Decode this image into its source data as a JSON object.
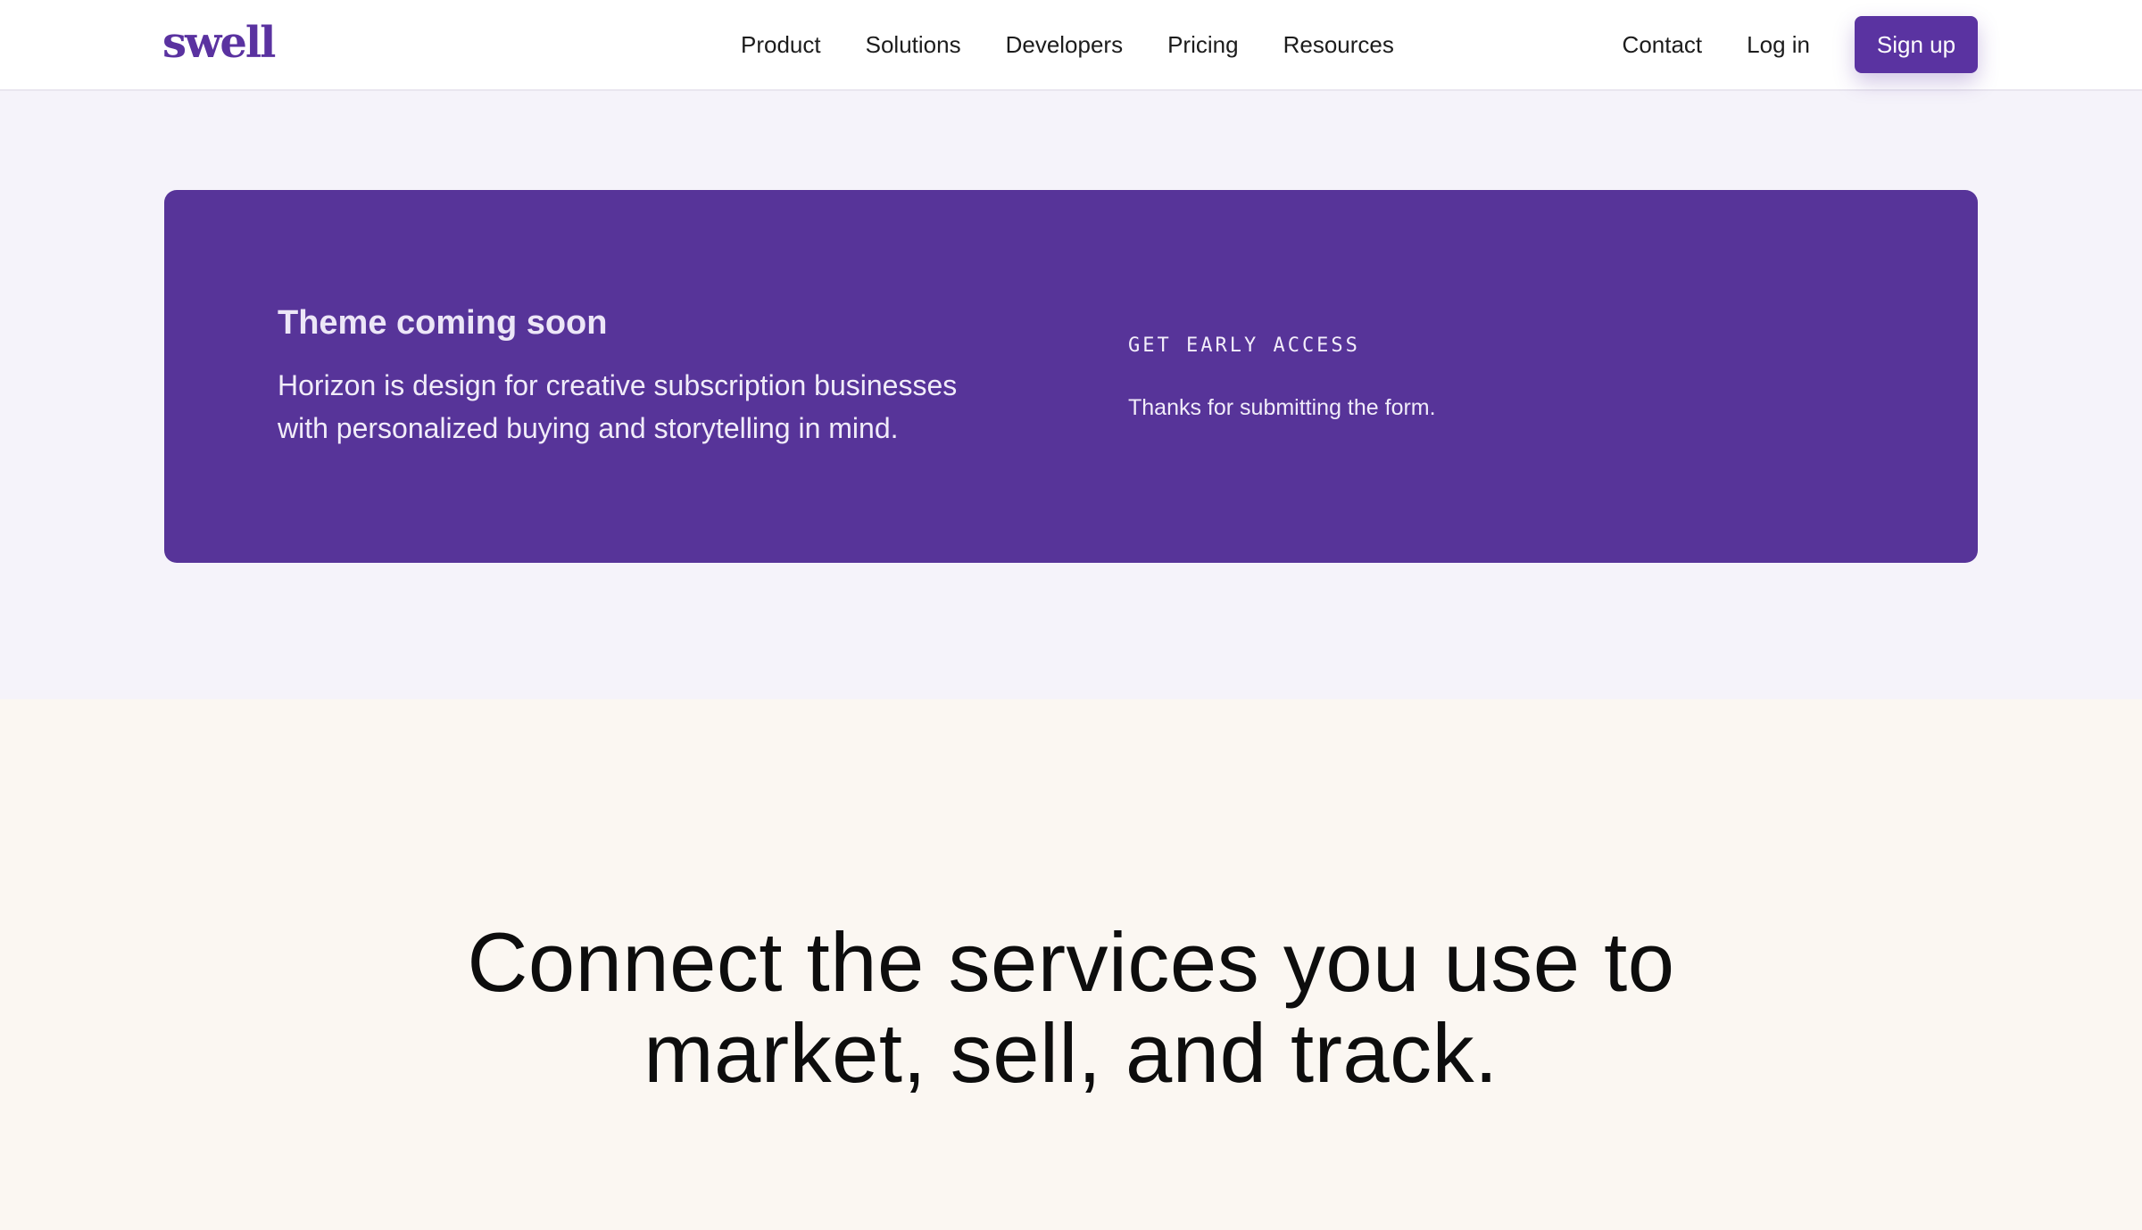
{
  "header": {
    "logo": "swell",
    "nav": [
      "Product",
      "Solutions",
      "Developers",
      "Pricing",
      "Resources"
    ],
    "contact": "Contact",
    "login": "Log in",
    "signup": "Sign up"
  },
  "promo": {
    "title": "Theme coming soon",
    "body": "Horizon is design for creative subscription businesses with personalized buying and storytelling in mind.",
    "early_access_label": "GET EARLY ACCESS",
    "thanks_message": "Thanks for submitting the form."
  },
  "connect": {
    "heading": "Connect the services you use to market, sell, and track."
  },
  "colors": {
    "brand": "#5a33a1",
    "card": "#573499",
    "lavender_bg": "#f5f3fa",
    "cream_bg": "#fbf7f2"
  }
}
